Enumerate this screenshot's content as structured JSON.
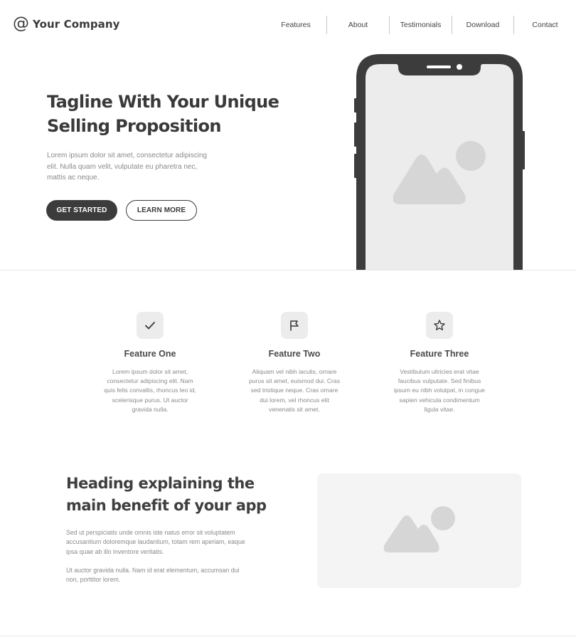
{
  "nav": {
    "brand_icon": "@",
    "brand_name": "Your Company",
    "links": [
      "Features",
      "About",
      "Testimonials",
      "Download",
      "Contact"
    ]
  },
  "hero": {
    "title": "Tagline With Your Unique Selling Proposition",
    "text": "Lorem ipsum dolor sit amet, consectetur adipiscing elit. Nulla quam velit, vulputate eu pharetra nec, mattis ac neque.",
    "primary_button": "GET STARTED",
    "secondary_button": "LEARN MORE",
    "phone_image_icon": "image-placeholder-icon"
  },
  "features": [
    {
      "icon": "check-icon",
      "title": "Feature One",
      "text": "Lorem ipsum dolor sit amet, consectetur adipiscing elit. Nam quis felis convallis, rhoncus leo id, scelerisque purus. Ut auctor gravida nulla."
    },
    {
      "icon": "flag-icon",
      "title": "Feature Two",
      "text": "Aliquam vel nibh iaculis, ornare purus sit amet, euismod dui. Cras sed tristique neque. Cras ornare dui lorem, vel rhoncus elit venenatis sit amet."
    },
    {
      "icon": "star-icon",
      "title": "Feature Three",
      "text": "Vestibulum ultricies erat vitae faucibus vulputate. Sed finibus ipsum eu nibh volutpat, in congue sapien vehicula condimentum ligula vitae."
    }
  ],
  "benefit": {
    "title": "Heading explaining the main benefit of your app",
    "paragraph1": "Sed ut perspiciatis unde omnis iste natus error sit voluptatem accusantium doloremque laudantium, totam rem aperiam, eaque ipsa quae ab illo inventore veritatis.",
    "paragraph2": "Ut auctor gravida nulla. Nam id erat elementum, accumsan dui non, porttitor lorem.",
    "image_icon": "image-placeholder-icon"
  },
  "colors": {
    "dark": "#3c3c3c",
    "muted_text": "#8a8a8a",
    "placeholder": "#d6d6d6",
    "screen": "#ececec"
  }
}
